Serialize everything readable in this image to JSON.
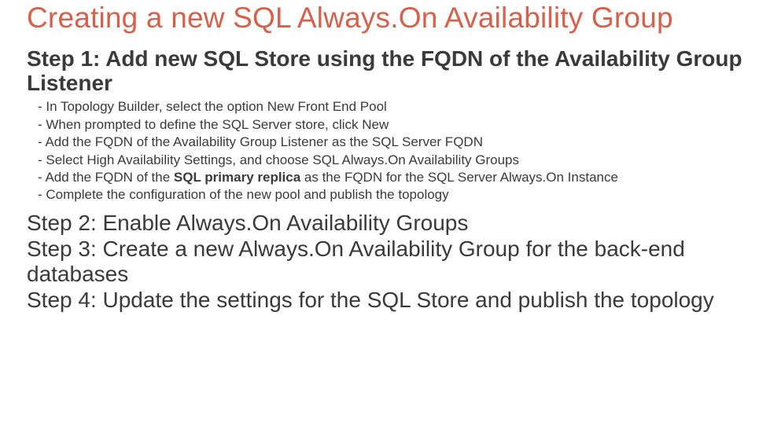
{
  "title": "Creating a new SQL Always.On Availability Group",
  "step1_heading": "Step 1: Add new SQL Store using the FQDN of the Availability Group Listener",
  "step1_bullets": {
    "b1": "- In Topology Builder, select the option New Front End Pool",
    "b2": "- When prompted to define the SQL Server store, click New",
    "b3": "- Add the FQDN of the Availability Group Listener as the SQL Server FQDN",
    "b4": "- Select High Availability Settings, and choose SQL Always.On Availability Groups",
    "b5a": "- Add the FQDN of the ",
    "b5_strong": "SQL primary replica",
    "b5b": " as the FQDN for the SQL Server Always.On Instance",
    "b6": "- Complete the configuration of the new pool and publish the topology"
  },
  "step2_heading": "Step 2: Enable Always.On Availability Groups",
  "step3_heading": "Step 3: Create a new Always.On Availability Group for the back-end databases",
  "step4_heading": "Step 4: Update the settings for the SQL Store and publish the topology"
}
